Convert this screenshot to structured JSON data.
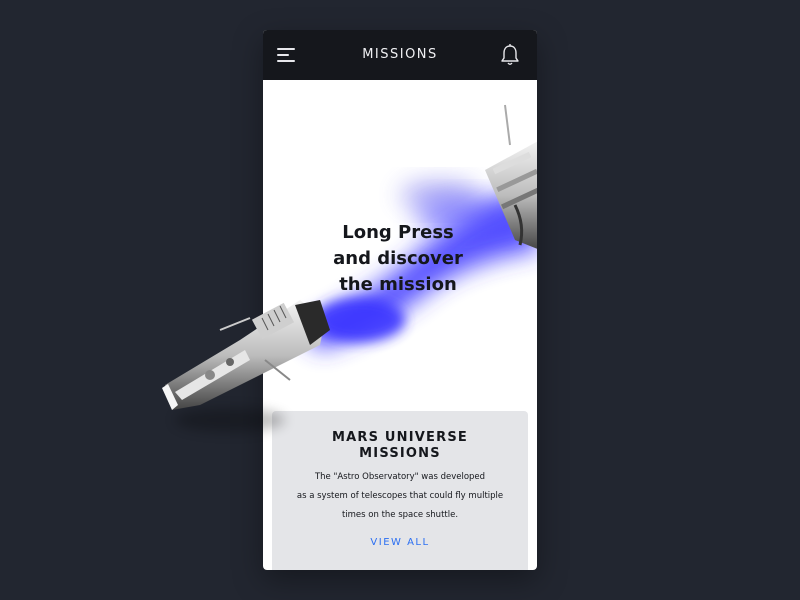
{
  "header": {
    "title": "MISSIONS",
    "menu_icon": "hamburger-menu-icon",
    "notification_icon": "bell-icon"
  },
  "hero": {
    "headline": "Long Press\nand discover\nthe mission",
    "illustration": "spacecraft-thruster-illustration"
  },
  "card": {
    "title": "MARS UNIVERSE\nMISSIONS",
    "description": "The \"Astro Observatory\" was developed\nas a system of  telescopes that could fly multiple\ntimes on the space shuttle.",
    "cta_label": "VIEW ALL"
  },
  "colors": {
    "background": "#222630",
    "header": "#15171c",
    "card": "#e4e5e8",
    "accent": "#2b6ff2",
    "exhaust": "#3a34ff"
  }
}
